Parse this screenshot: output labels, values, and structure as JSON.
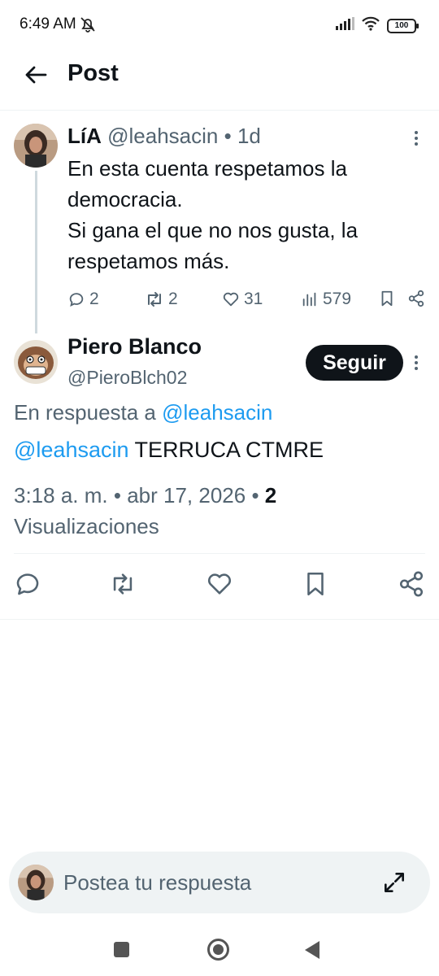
{
  "status": {
    "time": "6:49 AM",
    "battery": "100"
  },
  "header": {
    "title": "Post"
  },
  "parent_post": {
    "name": "LíA",
    "handle": "@leahsacin",
    "separator": "•",
    "age": "1d",
    "text_lines": [
      "En esta cuenta respetamos la",
      "democracia.",
      "Si gana el que no nos gusta, la",
      "respetamos más."
    ],
    "replies": "2",
    "reposts": "2",
    "likes": "31",
    "views": "579"
  },
  "reply_post": {
    "name": "Piero Blanco",
    "handle": "@PieroBlch02",
    "follow_label": "Seguir",
    "reply_to_prefix": "En respuesta a",
    "reply_to_handle": "@leahsacin",
    "mention": "@leahsacin",
    "text": "TERRUCA CTMRE",
    "time": "3:18 a. m.",
    "date": "abr 17, 2026",
    "meta_separator": "•",
    "views_count": "2",
    "views_label": "Visualizaciones"
  },
  "compose": {
    "placeholder": "Postea tu respuesta"
  },
  "colors": {
    "accent": "#1d9bf0",
    "text_primary": "#0f1419",
    "text_secondary": "#536471",
    "divider": "#eff3f4"
  }
}
